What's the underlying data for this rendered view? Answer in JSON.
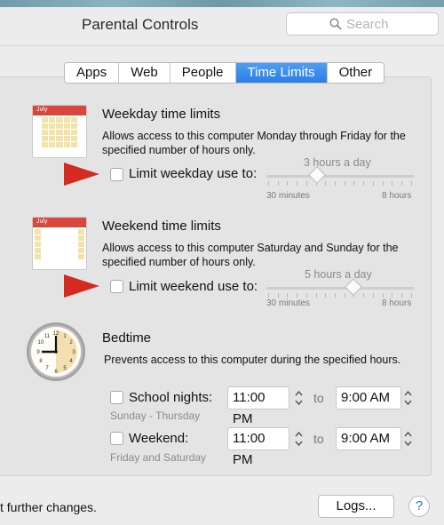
{
  "window": {
    "title": "Parental Controls"
  },
  "search": {
    "placeholder": "Search"
  },
  "tabs": [
    {
      "label": "Apps",
      "active": false
    },
    {
      "label": "Web",
      "active": false
    },
    {
      "label": "People",
      "active": false
    },
    {
      "label": "Time Limits",
      "active": true
    },
    {
      "label": "Other",
      "active": false
    }
  ],
  "weekday": {
    "calendar_month": "July",
    "heading": "Weekday time limits",
    "description": "Allows access to this computer Monday through Friday for the specified number of hours only.",
    "checkbox_label": "Limit weekday use to:",
    "checked": false,
    "slider_value": "3 hours a day",
    "slider_fraction": 0.33,
    "slider_min": "30 minutes",
    "slider_max": "8 hours"
  },
  "weekend": {
    "calendar_month": "July",
    "heading": "Weekend time limits",
    "description": "Allows access to this computer Saturday and Sunday for the specified number of hours only.",
    "checkbox_label": "Limit weekend use to:",
    "checked": false,
    "slider_value": "5 hours a day",
    "slider_fraction": 0.6,
    "slider_min": "30 minutes",
    "slider_max": "8 hours"
  },
  "bedtime": {
    "heading": "Bedtime",
    "description": "Prevents access to this computer during the specified hours.",
    "school_nights": {
      "label": "School nights:",
      "sublabel": "Sunday - Thursday",
      "start": "11:00 PM",
      "to": "to",
      "end": "9:00 AM",
      "checked": false
    },
    "weekend": {
      "label": "Weekend:",
      "sublabel": "Friday and Saturday",
      "start": "11:00 PM",
      "to": "to",
      "end": "9:00 AM",
      "checked": false
    }
  },
  "footer": {
    "lock_text": "t further changes.",
    "logs_button": "Logs...",
    "help_button": "?"
  },
  "colors": {
    "accent": "#2a7ee6",
    "arrow": "#d42a20",
    "calendar_header": "#d9463b"
  }
}
